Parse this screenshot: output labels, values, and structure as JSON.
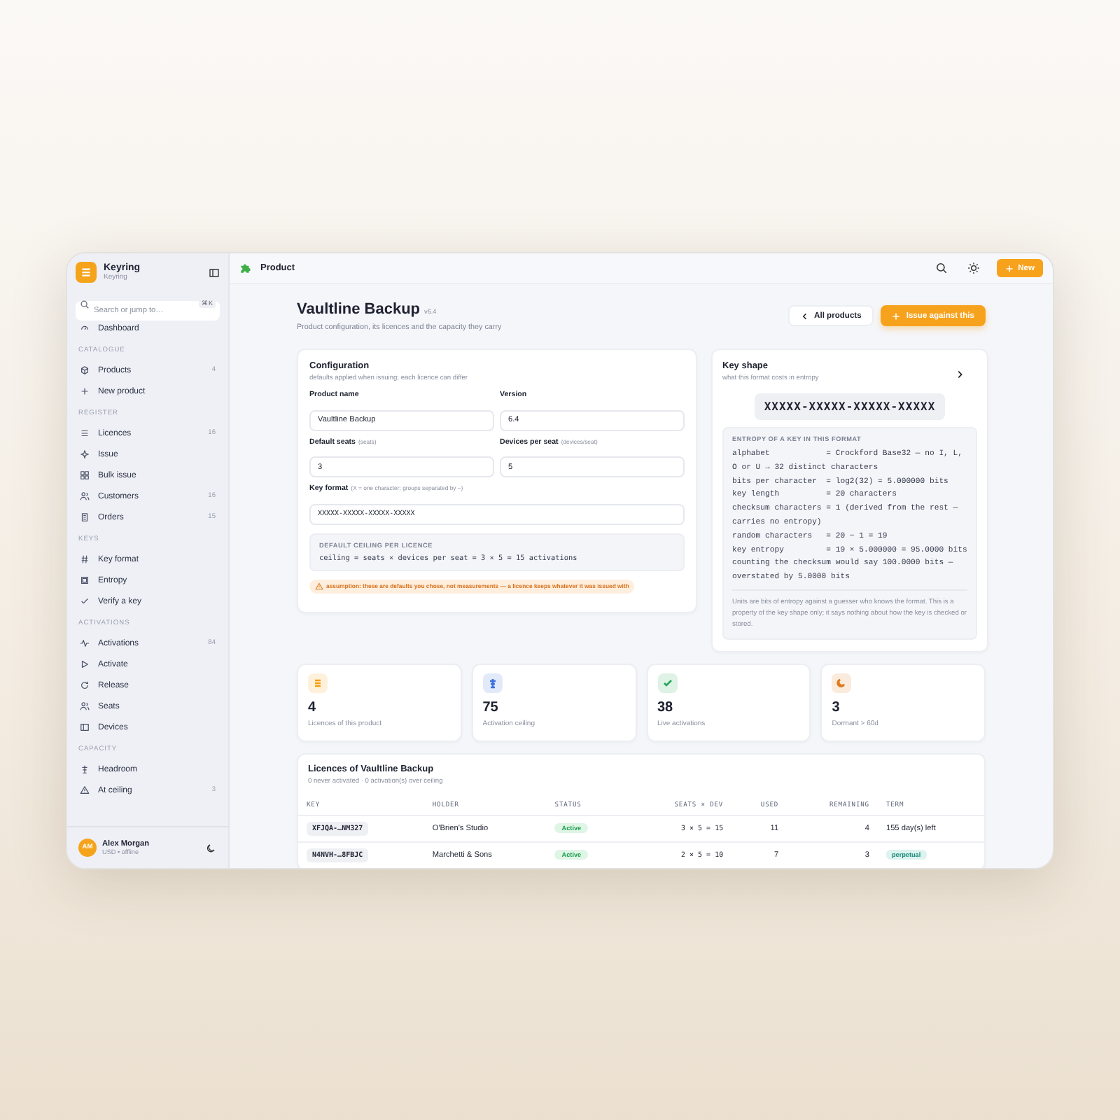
{
  "app": {
    "name": "Keyring",
    "subtitle": "Keyring"
  },
  "search": {
    "placeholder": "Search or jump to…",
    "shortcut": "⌘K"
  },
  "sidebar": {
    "sections": [
      {
        "items": [
          {
            "label": "Dashboard"
          }
        ]
      },
      {
        "title": "CATALOGUE",
        "items": [
          {
            "label": "Products",
            "count": "4"
          },
          {
            "label": "New product"
          }
        ]
      },
      {
        "title": "REGISTER",
        "items": [
          {
            "label": "Licences",
            "count": "16"
          },
          {
            "label": "Issue"
          },
          {
            "label": "Bulk issue"
          },
          {
            "label": "Customers",
            "count": "16"
          },
          {
            "label": "Orders",
            "count": "15"
          }
        ]
      },
      {
        "title": "KEYS",
        "items": [
          {
            "label": "Key format"
          },
          {
            "label": "Entropy"
          },
          {
            "label": "Verify a key"
          }
        ]
      },
      {
        "title": "ACTIVATIONS",
        "items": [
          {
            "label": "Activations",
            "count": "84"
          },
          {
            "label": "Activate"
          },
          {
            "label": "Release"
          },
          {
            "label": "Seats"
          },
          {
            "label": "Devices"
          }
        ]
      },
      {
        "title": "CAPACITY",
        "items": [
          {
            "label": "Headroom"
          },
          {
            "label": "At ceiling",
            "count": "3"
          }
        ]
      }
    ]
  },
  "user": {
    "initials": "AM",
    "name": "Alex Morgan",
    "status": "USD • offline"
  },
  "topbar": {
    "title": "Product",
    "new_button": "New"
  },
  "page": {
    "title": "Vaultline Backup",
    "version": "v6.4",
    "subtitle": "Product configuration, its licences and the capacity they carry",
    "back_button": "All products",
    "primary_button": "Issue against this"
  },
  "configuration": {
    "title": "Configuration",
    "subtitle": "defaults applied when issuing; each licence can differ",
    "fields": [
      {
        "kind": "text",
        "label": "Product name",
        "value": "Vaultline Backup"
      },
      {
        "kind": "text",
        "label": "Version",
        "value": "6.4"
      },
      {
        "kind": "text",
        "label": "Default seats",
        "hint": "(seats)",
        "value": "3"
      },
      {
        "kind": "text",
        "label": "Devices per seat",
        "hint": "(devices/seat)",
        "value": "5"
      },
      {
        "kind": "pattern",
        "label": "Key format",
        "hint": "(X = one character; groups separated by –)",
        "value": "XXXXX-XXXXX-XXXXX-XXXXX"
      }
    ],
    "ceiling": {
      "label": "DEFAULT CEILING PER LICENCE",
      "formula": "ceiling = seats × devices per seat = 3 × 5 = 15 activations"
    },
    "note": "assumption: these are defaults you chose, not measurements — a licence keeps whatever it was issued with"
  },
  "key_shape": {
    "title": "Key shape",
    "subtitle": "what this format costs in entropy",
    "pattern": "XXXXX-XXXXX-XXXXX-XXXXX",
    "entropy_label": "ENTROPY OF A KEY IN THIS FORMAT",
    "lines": [
      "alphabet            = Crockford Base32 — no I, L, O or U → 32 distinct characters",
      "bits per character  = log2(32) = 5.000000 bits",
      "key length          = 20 characters",
      "checksum characters = 1 (derived from the rest — carries no entropy)",
      "random characters   = 20 − 1 = 19",
      "key entropy         = 19 × 5.000000 = 95.0000 bits",
      "counting the checksum would say 100.0000 bits — overstated by 5.0000 bits"
    ],
    "footnote": "Units are bits of entropy against a guesser who knows the format. This is a property of the key shape only; it says nothing about how the key is checked or stored."
  },
  "stats": [
    {
      "value": "4",
      "label": "Licences of this product",
      "color": "#f59e0b"
    },
    {
      "value": "75",
      "label": "Activation ceiling",
      "color": "#3b6fe0"
    },
    {
      "value": "38",
      "label": "Live activations",
      "color": "#22a55a"
    },
    {
      "value": "3",
      "label": "Dormant > 60d",
      "color": "#e07b1c"
    }
  ],
  "licences": {
    "title": "Licences of Vaultline Backup",
    "subtitle": "0 never activated · 0 activation(s) over ceiling",
    "columns": [
      "KEY",
      "HOLDER",
      "STATUS",
      "SEATS × DEV",
      "USED",
      "REMAINING",
      "TERM"
    ],
    "rows": [
      {
        "key": "XFJQA-…NM327",
        "holder": "O'Brien's Studio",
        "status": "Active",
        "seats": "3 × 5 = 15",
        "used": "11",
        "remaining": "4",
        "term": {
          "kind": "text",
          "text": "155 day(s) left"
        }
      },
      {
        "key": "N4NVH-…8FBJC",
        "holder": "Marchetti & Sons",
        "status": "Active",
        "seats": "2 × 5 = 10",
        "used": "7",
        "remaining": "3",
        "term": {
          "kind": "badge",
          "text": "perpetual"
        }
      }
    ]
  }
}
